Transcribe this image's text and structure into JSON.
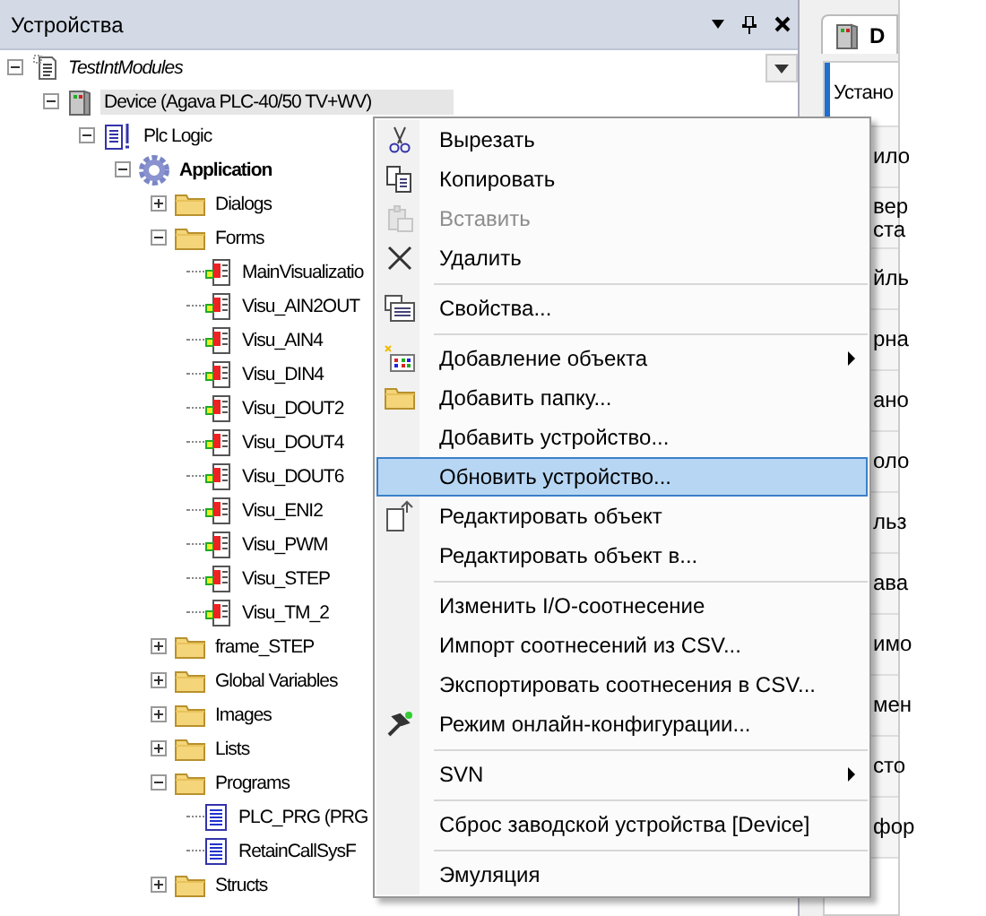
{
  "devices_panel": {
    "title": "Устройства",
    "tree": [
      {
        "label": "TestIntModules",
        "kind": "project",
        "italic": true,
        "expanded": true,
        "selected": false,
        "children": [
          {
            "label": "Device (Agava PLC-40/50 TV+WV)",
            "kind": "device",
            "expanded": true,
            "selected": true,
            "children": [
              {
                "label": "Plc Logic",
                "kind": "plc-logic",
                "expanded": true,
                "selected": false,
                "children": [
                  {
                    "label": "Application",
                    "kind": "application",
                    "bold": true,
                    "expanded": true,
                    "selected": false,
                    "children": [
                      {
                        "label": "Dialogs",
                        "kind": "folder",
                        "expanded": false,
                        "selected": false
                      },
                      {
                        "label": "Forms",
                        "kind": "folder",
                        "expanded": true,
                        "selected": false,
                        "children": [
                          {
                            "label": "MainVisualizatio",
                            "kind": "visu",
                            "selected": false
                          },
                          {
                            "label": "Visu_AIN2OUT",
                            "kind": "visu",
                            "selected": false
                          },
                          {
                            "label": "Visu_AIN4",
                            "kind": "visu",
                            "selected": false
                          },
                          {
                            "label": "Visu_DIN4",
                            "kind": "visu",
                            "selected": false
                          },
                          {
                            "label": "Visu_DOUT2",
                            "kind": "visu",
                            "selected": false
                          },
                          {
                            "label": "Visu_DOUT4",
                            "kind": "visu",
                            "selected": false
                          },
                          {
                            "label": "Visu_DOUT6",
                            "kind": "visu",
                            "selected": false
                          },
                          {
                            "label": "Visu_ENI2",
                            "kind": "visu",
                            "selected": false
                          },
                          {
                            "label": "Visu_PWM",
                            "kind": "visu",
                            "selected": false
                          },
                          {
                            "label": "Visu_STEP",
                            "kind": "visu",
                            "selected": false
                          },
                          {
                            "label": "Visu_TM_2",
                            "kind": "visu",
                            "selected": false
                          }
                        ]
                      },
                      {
                        "label": "frame_STEP",
                        "kind": "folder",
                        "expanded": false,
                        "selected": false
                      },
                      {
                        "label": "Global Variables",
                        "kind": "folder",
                        "expanded": false,
                        "selected": false
                      },
                      {
                        "label": "Images",
                        "kind": "folder",
                        "expanded": false,
                        "selected": false
                      },
                      {
                        "label": "Lists",
                        "kind": "folder",
                        "expanded": false,
                        "selected": false
                      },
                      {
                        "label": "Programs",
                        "kind": "folder",
                        "expanded": true,
                        "selected": false,
                        "children": [
                          {
                            "label": "PLC_PRG (PRG",
                            "kind": "program",
                            "selected": false
                          },
                          {
                            "label": "RetainCallSysF",
                            "kind": "program",
                            "selected": false
                          }
                        ]
                      },
                      {
                        "label": "Structs",
                        "kind": "folder",
                        "expanded": false,
                        "selected": false
                      }
                    ]
                  }
                ]
              }
            ]
          }
        ]
      }
    ]
  },
  "context_menu": [
    {
      "kind": "cut",
      "label": "Вырезать",
      "disabled": false,
      "selected": false,
      "submenu": false
    },
    {
      "kind": "copy",
      "label": "Копировать",
      "disabled": false,
      "selected": false,
      "submenu": false
    },
    {
      "kind": "paste",
      "label": "Вставить",
      "disabled": true,
      "selected": false,
      "submenu": false
    },
    {
      "kind": "delete",
      "label": "Удалить",
      "disabled": false,
      "selected": false,
      "submenu": false
    },
    {
      "kind": "separator"
    },
    {
      "kind": "properties",
      "label": "Свойства...",
      "disabled": false,
      "selected": false,
      "submenu": false
    },
    {
      "kind": "separator"
    },
    {
      "kind": "add-object",
      "label": "Добавление объекта",
      "disabled": false,
      "selected": false,
      "submenu": true
    },
    {
      "kind": "folder",
      "label": "Добавить папку...",
      "disabled": false,
      "selected": false,
      "submenu": false
    },
    {
      "kind": "plain",
      "label": "Добавить устройство...",
      "disabled": false,
      "selected": false,
      "submenu": false
    },
    {
      "kind": "plain",
      "label": "Обновить устройство...",
      "disabled": false,
      "selected": true,
      "submenu": false
    },
    {
      "kind": "edit",
      "label": "Редактировать объект",
      "disabled": false,
      "selected": false,
      "submenu": false
    },
    {
      "kind": "plain",
      "label": "Редактировать объект в...",
      "disabled": false,
      "selected": false,
      "submenu": false
    },
    {
      "kind": "separator"
    },
    {
      "kind": "plain",
      "label": "Изменить I/O-соотнесение",
      "disabled": false,
      "selected": false,
      "submenu": false
    },
    {
      "kind": "plain",
      "label": "Импорт соотнесений из CSV...",
      "disabled": false,
      "selected": false,
      "submenu": false
    },
    {
      "kind": "plain",
      "label": "Экспортировать соотнесения в CSV...",
      "disabled": false,
      "selected": false,
      "submenu": false
    },
    {
      "kind": "wrench",
      "label": "Режим онлайн-конфигурации...",
      "disabled": false,
      "selected": false,
      "submenu": false
    },
    {
      "kind": "separator"
    },
    {
      "kind": "plain",
      "label": "SVN",
      "disabled": false,
      "selected": false,
      "submenu": true
    },
    {
      "kind": "separator"
    },
    {
      "kind": "plain",
      "label": "Сброс заводской устройства [Device]",
      "disabled": false,
      "selected": false,
      "submenu": false
    },
    {
      "kind": "separator"
    },
    {
      "kind": "plain",
      "label": "Эмуляция",
      "disabled": false,
      "selected": false,
      "submenu": false
    }
  ],
  "editor_panel": {
    "tab": {
      "label": "D",
      "selected": true
    },
    "rows": [
      {
        "label": "Устано",
        "selected": true
      },
      {
        "label": "ило",
        "selected": false
      },
      {
        "label": "вер\nста",
        "selected": false
      },
      {
        "label": "йль",
        "selected": false
      },
      {
        "label": "рна",
        "selected": false
      },
      {
        "label": "ано",
        "selected": false
      },
      {
        "label": "оло",
        "selected": false
      },
      {
        "label": "льз",
        "selected": false
      },
      {
        "label": "ава",
        "selected": false
      },
      {
        "label": "имо",
        "selected": false
      },
      {
        "label": "мен",
        "selected": false
      },
      {
        "label": "сто",
        "selected": false
      },
      {
        "label": "фор",
        "selected": false
      }
    ]
  }
}
